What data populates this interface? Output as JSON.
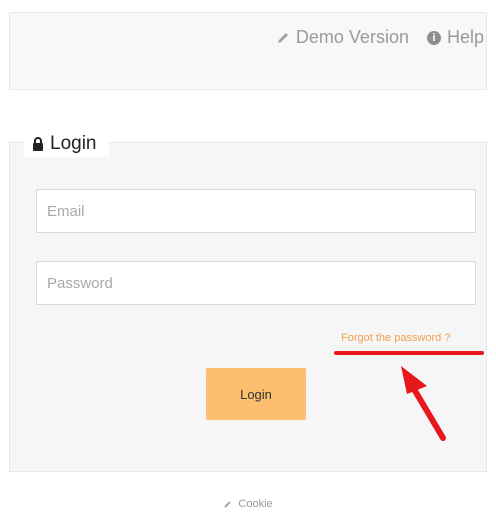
{
  "header": {
    "demo_label": "Demo Version",
    "help_label": "Help"
  },
  "login": {
    "legend": "Login",
    "email_placeholder": "Email",
    "password_placeholder": "Password",
    "forgot_label": "Forgot the password ?",
    "button_label": "Login"
  },
  "footer": {
    "cookie_label": "Cookie"
  },
  "icons": {
    "demo": "pencil-icon",
    "help": "info-circle-icon",
    "lock": "lock-icon",
    "annotation": "red-arrow-icon"
  },
  "colors": {
    "accent_button": "#fbbf6f",
    "forgot_link": "#f0a050",
    "annotation_red": "#e8171b"
  }
}
